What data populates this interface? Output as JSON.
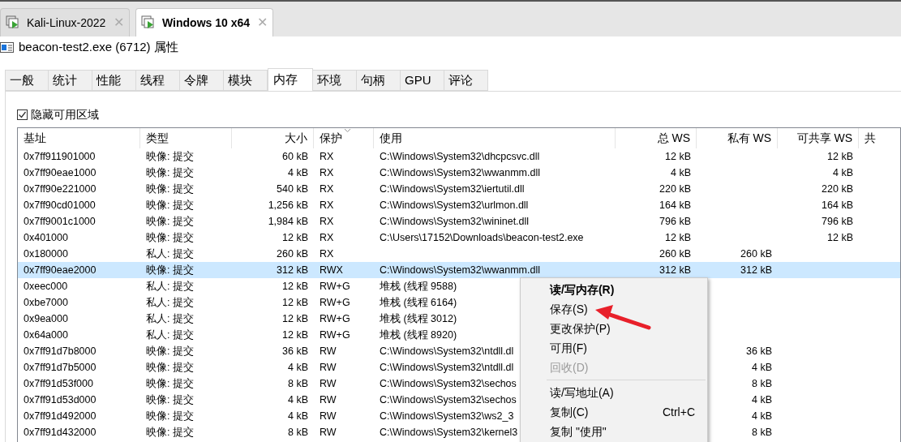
{
  "vm_tabs": [
    {
      "label": "Kali-Linux-2022",
      "close": "✕",
      "selected": false
    },
    {
      "label": "Windows 10 x64",
      "close": "✕",
      "selected": true
    }
  ],
  "window": {
    "title": "beacon-test2.exe (6712) 属性"
  },
  "tabs": [
    {
      "label": "一般",
      "selected": false
    },
    {
      "label": "统计",
      "selected": false
    },
    {
      "label": "性能",
      "selected": false
    },
    {
      "label": "线程",
      "selected": false
    },
    {
      "label": "令牌",
      "selected": false
    },
    {
      "label": "模块",
      "selected": false
    },
    {
      "label": "内存",
      "selected": true
    },
    {
      "label": "环境",
      "selected": false
    },
    {
      "label": "句柄",
      "selected": false
    },
    {
      "label": "GPU",
      "selected": false
    },
    {
      "label": "评论",
      "selected": false
    }
  ],
  "hide_free_regions": {
    "label": "隐藏可用区域",
    "checked": true
  },
  "table": {
    "columns": [
      {
        "label": "基址",
        "sorted": false
      },
      {
        "label": "类型",
        "sorted": false
      },
      {
        "label": "大小",
        "sorted": false
      },
      {
        "label": "保护",
        "sorted": true
      },
      {
        "label": "使用",
        "sorted": false
      },
      {
        "label": "总 WS",
        "sorted": false
      },
      {
        "label": "私有 WS",
        "sorted": false
      },
      {
        "label": "可共享 WS",
        "sorted": false
      },
      {
        "label": "共",
        "sorted": false
      }
    ],
    "rows": [
      {
        "cells": [
          "0x7ff911901000",
          "映像: 提交",
          "60 kB",
          "RX",
          "C:\\Windows\\System32\\dhcpcsvc.dll",
          "12 kB",
          "",
          "12 kB"
        ],
        "selected": false
      },
      {
        "cells": [
          "0x7ff90eae1000",
          "映像: 提交",
          "4 kB",
          "RX",
          "C:\\Windows\\System32\\wwanmm.dll",
          "4 kB",
          "",
          "4 kB"
        ],
        "selected": false
      },
      {
        "cells": [
          "0x7ff90e221000",
          "映像: 提交",
          "540 kB",
          "RX",
          "C:\\Windows\\System32\\iertutil.dll",
          "220 kB",
          "",
          "220 kB"
        ],
        "selected": false
      },
      {
        "cells": [
          "0x7ff90cd01000",
          "映像: 提交",
          "1,256 kB",
          "RX",
          "C:\\Windows\\System32\\urlmon.dll",
          "164 kB",
          "",
          "164 kB"
        ],
        "selected": false
      },
      {
        "cells": [
          "0x7ff9001c1000",
          "映像: 提交",
          "1,984 kB",
          "RX",
          "C:\\Windows\\System32\\wininet.dll",
          "796 kB",
          "",
          "796 kB"
        ],
        "selected": false
      },
      {
        "cells": [
          "0x401000",
          "映像: 提交",
          "12 kB",
          "RX",
          "C:\\Users\\17152\\Downloads\\beacon-test2.exe",
          "12 kB",
          "",
          "12 kB"
        ],
        "selected": false
      },
      {
        "cells": [
          "0x180000",
          "私人: 提交",
          "260 kB",
          "RX",
          "",
          "260 kB",
          "260 kB",
          ""
        ],
        "selected": false
      },
      {
        "cells": [
          "0x7ff90eae2000",
          "映像: 提交",
          "312 kB",
          "RWX",
          "C:\\Windows\\System32\\wwanmm.dll",
          "312 kB",
          "312 kB",
          ""
        ],
        "selected": true
      },
      {
        "cells": [
          "0xeec000",
          "私人: 提交",
          "12 kB",
          "RW+G",
          "堆栈 (线程 9588)",
          "",
          "",
          ""
        ],
        "selected": false
      },
      {
        "cells": [
          "0xbe7000",
          "私人: 提交",
          "12 kB",
          "RW+G",
          "堆栈 (线程 6164)",
          "",
          "",
          ""
        ],
        "selected": false
      },
      {
        "cells": [
          "0x9ea000",
          "私人: 提交",
          "12 kB",
          "RW+G",
          "堆栈 (线程 3012)",
          "",
          "",
          ""
        ],
        "selected": false
      },
      {
        "cells": [
          "0x64a000",
          "私人: 提交",
          "12 kB",
          "RW+G",
          "堆栈 (线程 8920)",
          "",
          "",
          ""
        ],
        "selected": false
      },
      {
        "cells": [
          "0x7ff91d7b8000",
          "映像: 提交",
          "36 kB",
          "RW",
          "C:\\Windows\\System32\\ntdll.dl",
          "",
          "36 kB",
          ""
        ],
        "selected": false
      },
      {
        "cells": [
          "0x7ff91d7b5000",
          "映像: 提交",
          "4 kB",
          "RW",
          "C:\\Windows\\System32\\ntdll.dl",
          "",
          "4 kB",
          ""
        ],
        "selected": false
      },
      {
        "cells": [
          "0x7ff91d53f000",
          "映像: 提交",
          "8 kB",
          "RW",
          "C:\\Windows\\System32\\sechos",
          "",
          "8 kB",
          ""
        ],
        "selected": false
      },
      {
        "cells": [
          "0x7ff91d53d000",
          "映像: 提交",
          "4 kB",
          "RW",
          "C:\\Windows\\System32\\sechos",
          "",
          "4 kB",
          ""
        ],
        "selected": false
      },
      {
        "cells": [
          "0x7ff91d492000",
          "映像: 提交",
          "4 kB",
          "RW",
          "C:\\Windows\\System32\\ws2_3",
          "",
          "4 kB",
          ""
        ],
        "selected": false
      },
      {
        "cells": [
          "0x7ff91d432000",
          "映像: 提交",
          "8 kB",
          "RW",
          "C:\\Windows\\System32\\kernel3",
          "",
          "8 kB",
          ""
        ],
        "selected": false
      }
    ]
  },
  "context_menu": [
    {
      "kind": "item",
      "label": "读/写内存(R)",
      "default": true,
      "disabled": false
    },
    {
      "kind": "item",
      "label": "保存(S)",
      "default": false,
      "disabled": false
    },
    {
      "kind": "item",
      "label": "更改保护(P)",
      "default": false,
      "disabled": false
    },
    {
      "kind": "item",
      "label": "可用(F)",
      "default": false,
      "disabled": false
    },
    {
      "kind": "item",
      "label": "回收(D)",
      "default": false,
      "disabled": true
    },
    {
      "kind": "separator"
    },
    {
      "kind": "item",
      "label": "读/写地址(A)",
      "default": false,
      "disabled": false
    },
    {
      "kind": "item",
      "label": "复制(C)",
      "shortcut": "Ctrl+C",
      "default": false,
      "disabled": false
    },
    {
      "kind": "item",
      "label": "复制 \"使用\"",
      "default": false,
      "disabled": false
    }
  ]
}
